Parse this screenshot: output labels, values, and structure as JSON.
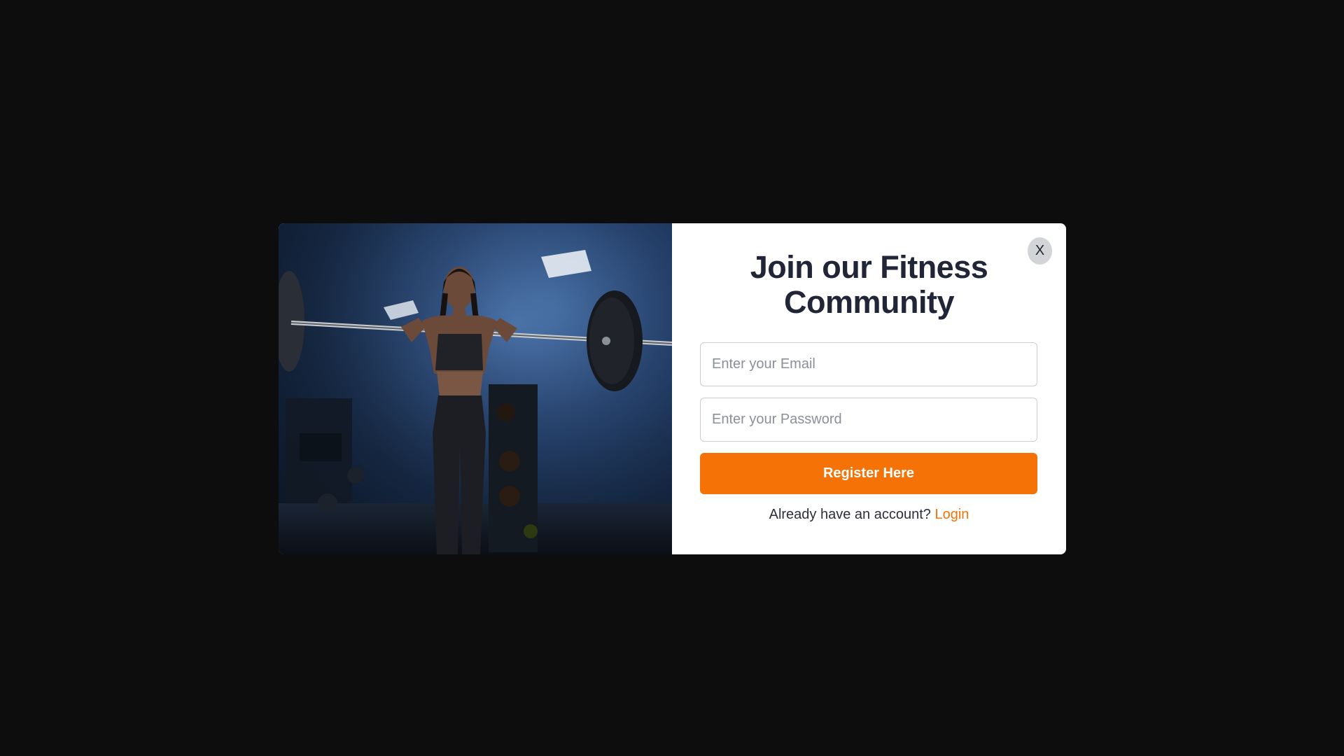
{
  "modal": {
    "close_label": "X",
    "title_line1": "Join our Fitness",
    "title_line2": "Community",
    "email_placeholder": "Enter your Email",
    "password_placeholder": "Enter your Password",
    "register_label": "Register Here",
    "footer_text": "Already have an account?",
    "login_label": "Login"
  },
  "colors": {
    "accent": "#f57206",
    "title": "#202637",
    "backdrop": "#0d0d0e"
  },
  "hero_image": {
    "subject": "woman holding barbell in gym"
  }
}
